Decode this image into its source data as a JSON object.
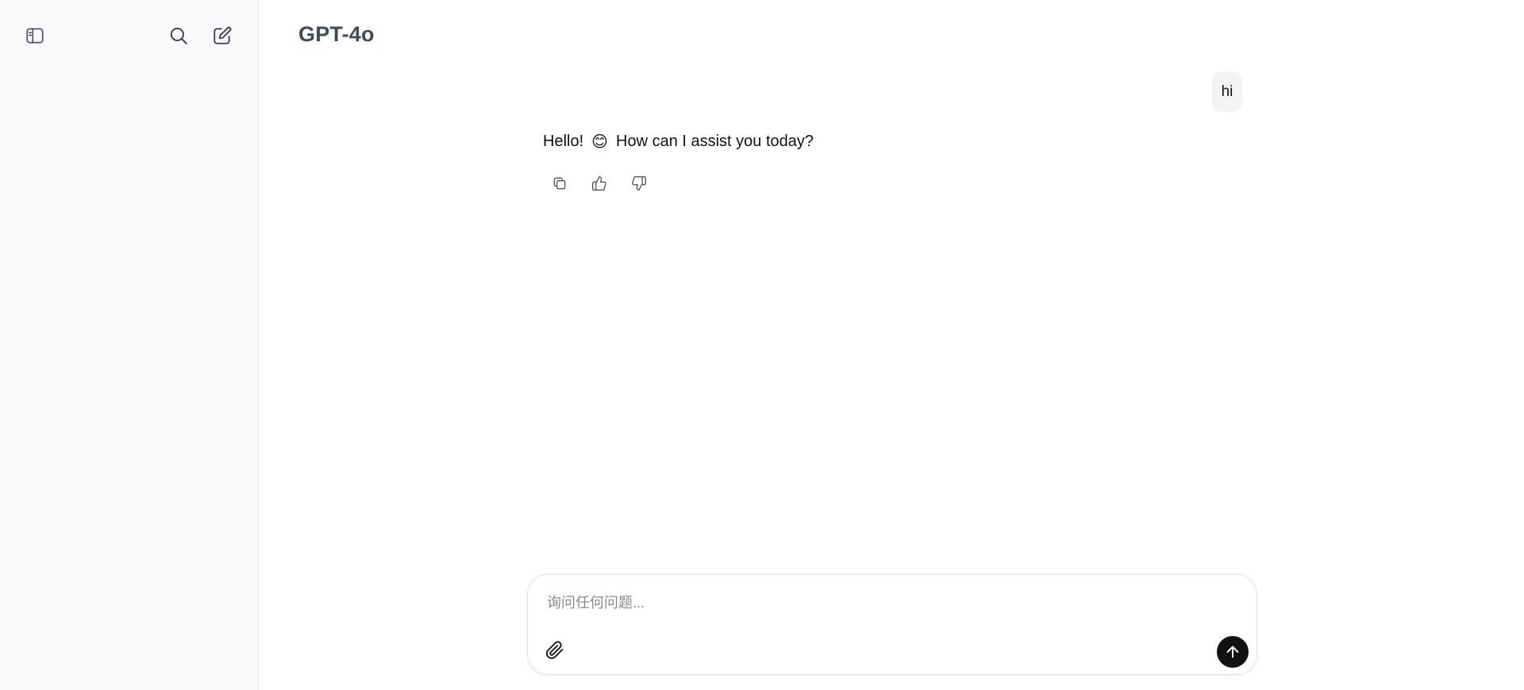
{
  "sidebar": {
    "toggle_icon": "sidebar-toggle-icon",
    "search_icon": "search-icon",
    "new_chat_icon": "new-chat-icon"
  },
  "header": {
    "model_title": "GPT-4o"
  },
  "conversation": {
    "user_message": "hi",
    "assistant_message": {
      "before_emoji": "Hello!",
      "emoji": "😊",
      "after_emoji": "How can I assist you today?"
    },
    "actions": [
      "copy-icon",
      "thumbs-up-icon",
      "thumbs-down-icon"
    ]
  },
  "composer": {
    "placeholder": "询问任何问题...",
    "value": "",
    "attach_icon": "paperclip-icon",
    "send_icon": "arrow-up-icon"
  },
  "colors": {
    "sidebar_bg": "#f9f9fb",
    "title": "#3f4a5a",
    "send_button": "#111111",
    "user_bubble": "#f4f4f5"
  }
}
